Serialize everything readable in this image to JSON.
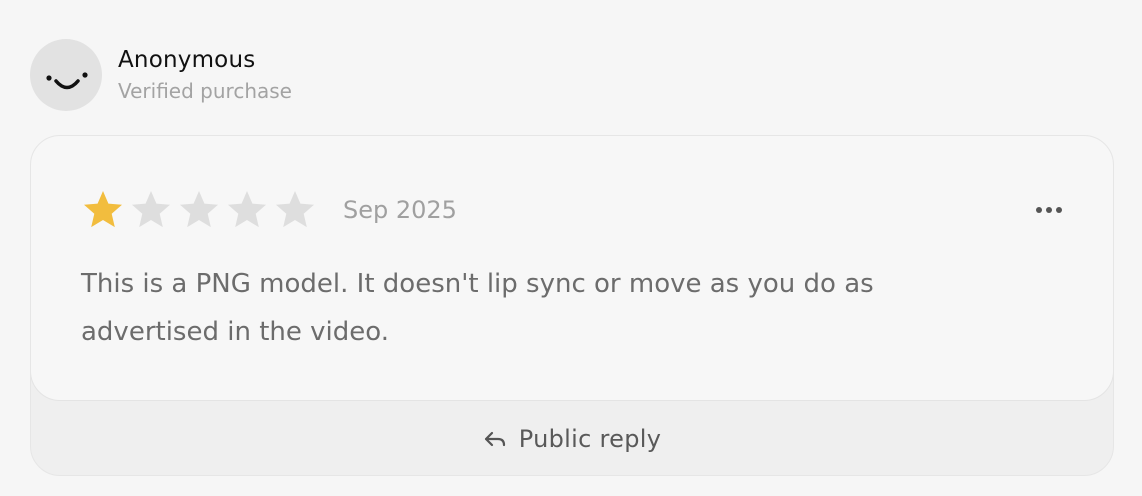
{
  "reviewer": {
    "name": "Anonymous",
    "badge": "Verified purchase",
    "avatar_icon": "smiley-face-icon"
  },
  "review": {
    "rating": 1,
    "max_rating": 5,
    "date": "Sep 2025",
    "text": "This is a PNG model. It doesn't lip sync or move as you do as advertised in the video.",
    "more_icon": "more-horizontal-icon"
  },
  "reply": {
    "label": "Public reply",
    "icon": "reply-arrow-icon"
  },
  "colors": {
    "star_filled": "#f2bd3e",
    "star_empty": "#dedede"
  }
}
